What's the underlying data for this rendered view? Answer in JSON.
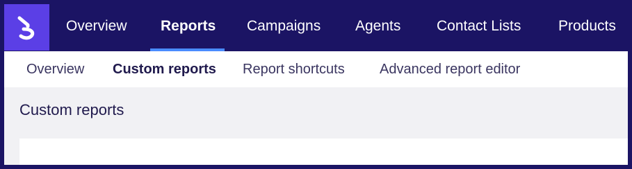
{
  "app": {
    "logo_icon": "brand-logo-icon",
    "accent_color": "#5b3fe6",
    "nav_background": "#1b1464",
    "active_underline_color": "#4a8cff"
  },
  "top_nav": {
    "items": [
      {
        "label": "Overview",
        "active": false
      },
      {
        "label": "Reports",
        "active": true
      },
      {
        "label": "Campaigns",
        "active": false
      },
      {
        "label": "Agents",
        "active": false
      },
      {
        "label": "Contact Lists",
        "active": false
      },
      {
        "label": "Products",
        "active": false
      }
    ]
  },
  "sub_nav": {
    "items": [
      {
        "label": "Overview",
        "active": false
      },
      {
        "label": "Custom reports",
        "active": true
      },
      {
        "label": "Report shortcuts",
        "active": false
      },
      {
        "label": "Advanced report editor",
        "active": false
      }
    ]
  },
  "main": {
    "title": "Custom reports"
  }
}
